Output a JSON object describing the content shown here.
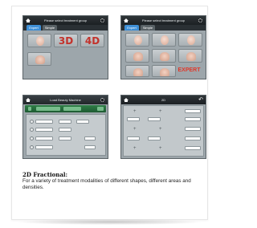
{
  "screen_top_left": {
    "title": "Please select treatment group",
    "tabs": [
      {
        "label": "Expert",
        "active": true
      },
      {
        "label": "Simple",
        "active": false
      }
    ],
    "big_labels": [
      "3D",
      "4D"
    ]
  },
  "screen_top_right": {
    "title": "Please select treatment group",
    "tabs": [
      {
        "label": "Expert",
        "active": true
      },
      {
        "label": "Simple",
        "active": false
      }
    ],
    "expert_label": "EXPERT"
  },
  "screen_bottom_left": {
    "title": "Load Beauty Machine"
  },
  "screen_bottom_right": {
    "title": "2D"
  },
  "caption": {
    "heading": "2D Fractional:",
    "text": "For a variety of treatment modalities of different shapes, different areas and densities."
  },
  "colors": {
    "tab_active": "#3e8fd6",
    "accent_red": "#e0382a",
    "panel_green": "#2e7d46"
  }
}
